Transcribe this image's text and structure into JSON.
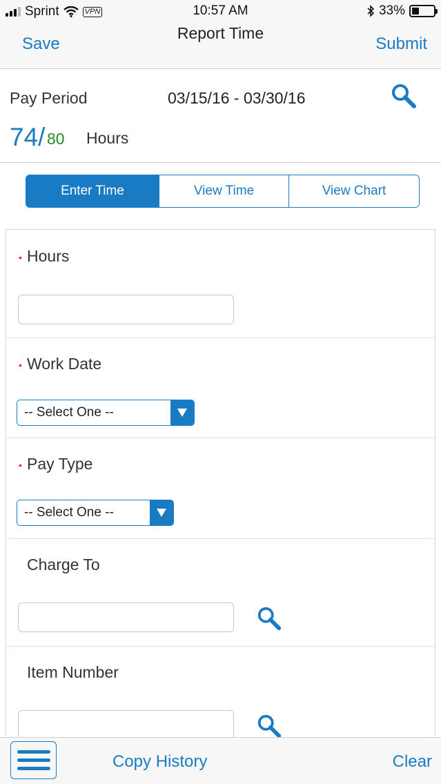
{
  "status_bar": {
    "carrier": "Sprint",
    "vpn": "VPN",
    "time": "10:57 AM",
    "battery": "33%",
    "battery_level": 0.33,
    "icons": [
      "signal-icon",
      "wifi-icon",
      "bluetooth-icon",
      "battery-icon"
    ]
  },
  "nav": {
    "save": "Save",
    "title": "Report Time",
    "submit": "Submit"
  },
  "period": {
    "label": "Pay Period",
    "range": "03/15/16 - 03/30/16",
    "hours_worked": "74/",
    "hours_total": "80",
    "hours_label": "Hours"
  },
  "tabs": [
    {
      "label": "Enter Time",
      "active": true
    },
    {
      "label": "View Time",
      "active": false
    },
    {
      "label": "View Chart",
      "active": false
    }
  ],
  "form": {
    "hours": {
      "label": "Hours",
      "required": true,
      "value": ""
    },
    "work_date": {
      "label": "Work Date",
      "required": true,
      "selected": "-- Select One --"
    },
    "pay_type": {
      "label": "Pay Type",
      "required": true,
      "selected": "-- Select One --"
    },
    "charge_to": {
      "label": "Charge To",
      "required": false,
      "value": ""
    },
    "item_number": {
      "label": "Item Number",
      "required": false,
      "value": ""
    },
    "required_marker": "•"
  },
  "toolbar": {
    "copy_history": "Copy History",
    "clear": "Clear"
  },
  "colors": {
    "accent": "#1a7bc5",
    "total_hours": "#2a8a2a",
    "required": "#d9342b"
  }
}
